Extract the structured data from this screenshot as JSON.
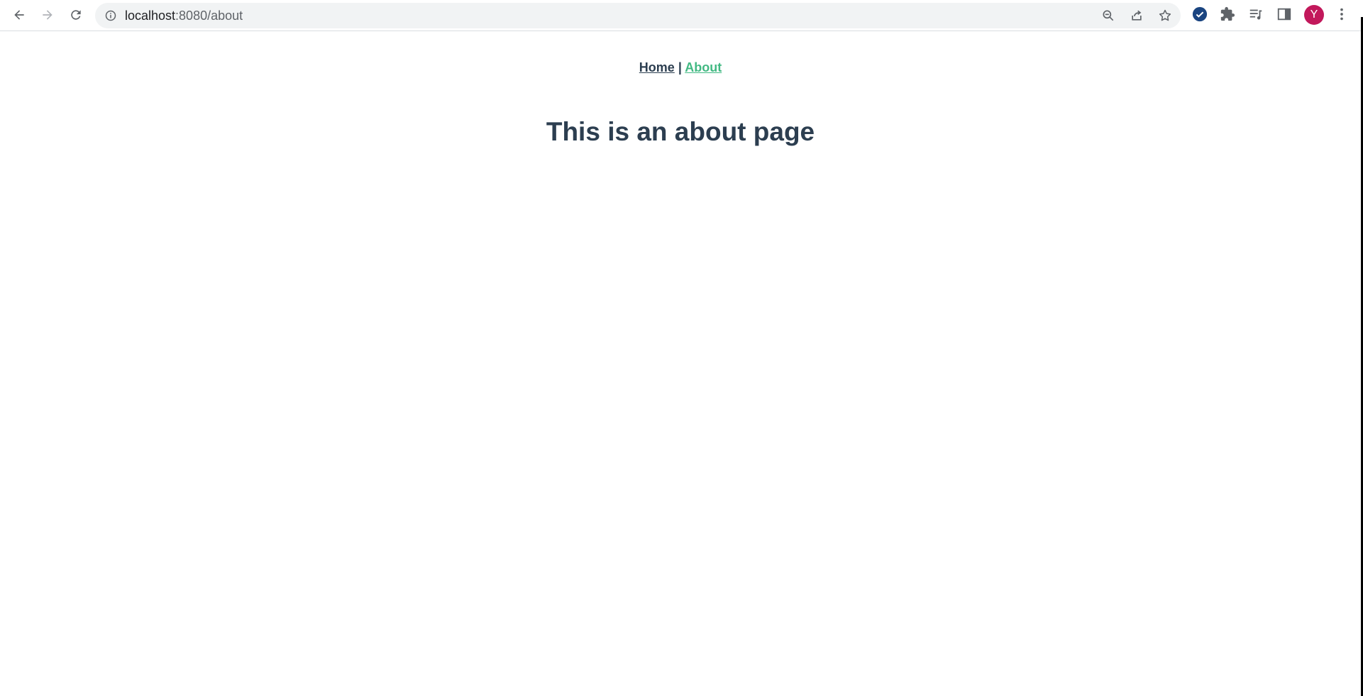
{
  "browser": {
    "url_host": "localhost",
    "url_rest": ":8080/about",
    "profile_initial": "Y"
  },
  "icons": {
    "back": "arrow-left-icon",
    "forward": "arrow-right-icon",
    "reload": "reload-icon",
    "site_info": "info-icon",
    "zoom": "zoom-out-icon",
    "share": "share-icon",
    "bookmark": "star-icon",
    "extension_check": "check-circle-icon",
    "extensions": "puzzle-icon",
    "media": "media-queue-icon",
    "side_panel": "side-panel-icon",
    "menu": "more-vert-icon"
  },
  "nav": {
    "home_label": "Home",
    "separator": "|",
    "about_label": "About"
  },
  "main": {
    "heading": "This is an about page"
  },
  "colors": {
    "text": "#2c3e50",
    "active_link": "#42b983",
    "avatar": "#c2185b",
    "extension_check": "#1a4480"
  }
}
